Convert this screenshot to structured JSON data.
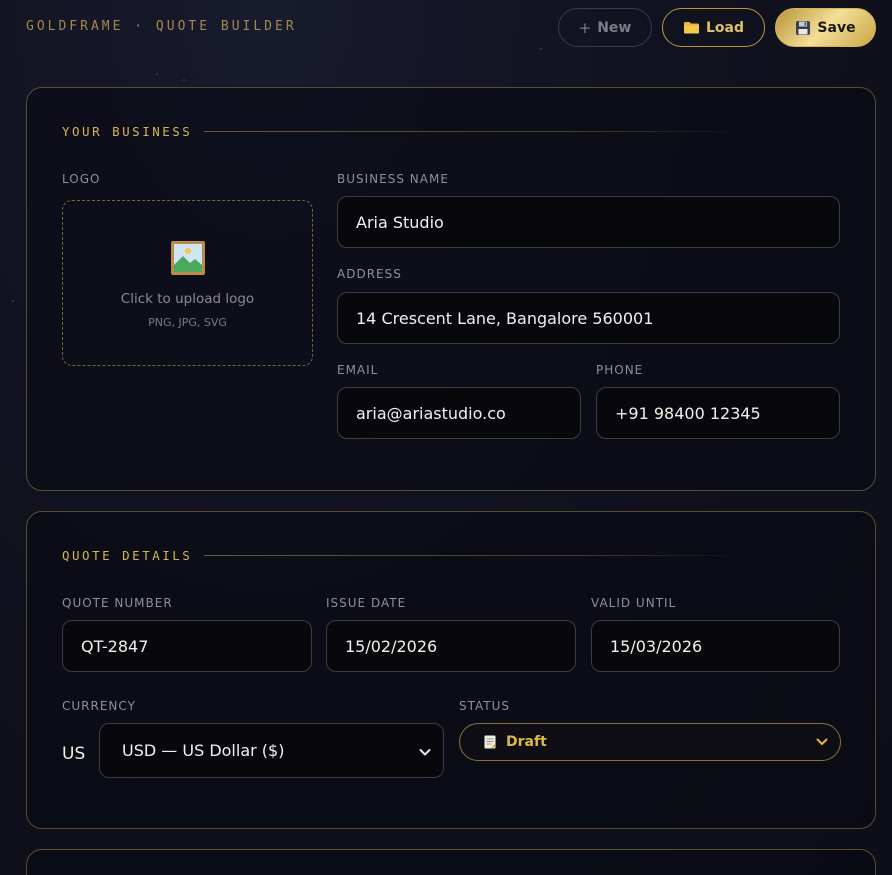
{
  "header": {
    "brand": "GOLDFRAME · QUOTE BUILDER",
    "buttons": {
      "new": {
        "icon": "plus-icon",
        "label": "New"
      },
      "load": {
        "icon": "folder-icon",
        "label": "Load"
      },
      "save": {
        "icon": "floppy-disk-icon",
        "label": "Save"
      }
    }
  },
  "business": {
    "section_title": "YOUR BUSINESS",
    "logo": {
      "label": "LOGO",
      "icon": "framed-picture-icon",
      "hint": "Click to upload logo",
      "formats": "PNG, JPG, SVG"
    },
    "name": {
      "label": "BUSINESS NAME",
      "value": "Aria Studio"
    },
    "address": {
      "label": "ADDRESS",
      "value": "14 Crescent Lane, Bangalore 560001"
    },
    "email": {
      "label": "EMAIL",
      "value": "aria@ariastudio.co"
    },
    "phone": {
      "label": "PHONE",
      "value": "+91 98400 12345"
    }
  },
  "quote": {
    "section_title": "QUOTE DETAILS",
    "number": {
      "label": "QUOTE NUMBER",
      "value": "QT-2847"
    },
    "issue_date": {
      "label": "ISSUE DATE",
      "value": "15/02/2026"
    },
    "valid_until": {
      "label": "VALID UNTIL",
      "value": "15/03/2026"
    },
    "currency": {
      "label": "CURRENCY",
      "symbol": "US",
      "selected": "USD — US Dollar ($)"
    },
    "status": {
      "label": "STATUS",
      "icon": "memo-icon",
      "selected": "Draft"
    }
  },
  "colors": {
    "accent_gold": "#d6b352",
    "background": "#11121f",
    "field_background": "#08080c",
    "card_border": "#5a4d2c"
  }
}
